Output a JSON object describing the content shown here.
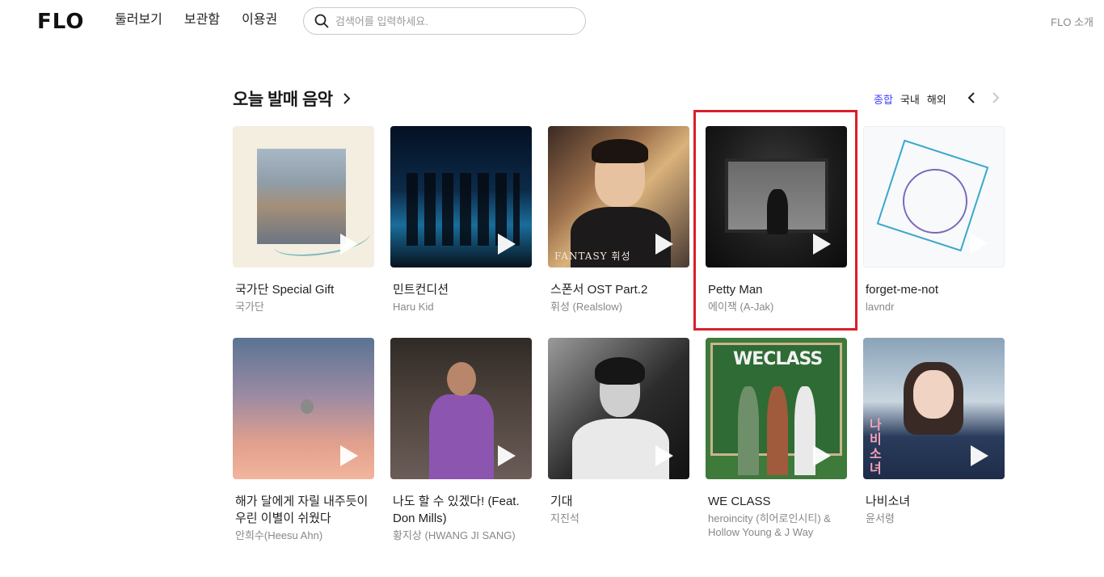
{
  "header": {
    "logo": "FLO",
    "nav": [
      "둘러보기",
      "보관함",
      "이용권"
    ],
    "search_placeholder": "검색어를 입력하세요.",
    "about": "FLO 소개"
  },
  "section": {
    "title": "오늘 발매 음악",
    "filters": [
      {
        "label": "종합",
        "active": true
      },
      {
        "label": "국내",
        "active": false
      },
      {
        "label": "해외",
        "active": false
      }
    ]
  },
  "albums": [
    {
      "title": "국가단 Special Gift",
      "artist": "국가단"
    },
    {
      "title": "민트컨디션",
      "artist": "Haru Kid"
    },
    {
      "title": "스폰서 OST Part.2",
      "artist": "휘성 (Realslow)"
    },
    {
      "title": "Petty Man",
      "artist": "에이잭 (A-Jak)"
    },
    {
      "title": "forget-me-not",
      "artist": "lavndr"
    },
    {
      "title": "해가 달에게 자릴 내주듯이 우린 이별이 쉬웠다",
      "artist": "안희수(Heesu Ahn)"
    },
    {
      "title": "나도 할 수 있겠다! (Feat. Don Mills)",
      "artist": "황지상 (HWANG JI SANG)"
    },
    {
      "title": "기대",
      "artist": "지진석"
    },
    {
      "title": "WE CLASS",
      "artist": "heroincity (히어로인시티) & Hollow Young & J Way"
    },
    {
      "title": "나비소녀",
      "artist": "윤서령"
    }
  ],
  "art_text": {
    "a3_caption": "FANTASY 휘성",
    "a9_logo": "WECLASS",
    "a10_vertical": "나비소녀"
  },
  "colors": {
    "accent": "#3f3fff",
    "highlight_box": "#d9202a"
  }
}
